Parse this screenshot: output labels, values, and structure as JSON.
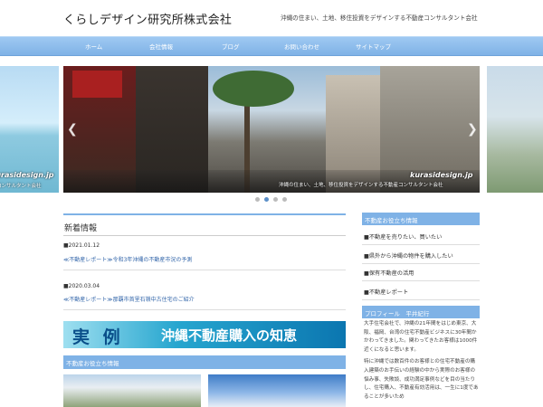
{
  "header": {
    "site_title": "くらしデザイン研究所株式会社",
    "tagline": "沖縄の住まい、土地、移住投資をデザインする不動産コンサルタント会社"
  },
  "nav": {
    "items": [
      {
        "label": "ホーム"
      },
      {
        "label": "会社情報"
      },
      {
        "label": "ブログ"
      },
      {
        "label": "お問い合わせ"
      },
      {
        "label": "サイトマップ"
      }
    ]
  },
  "slider": {
    "watermark": "kurasidesign.jp",
    "caption": "沖縄の住まい、土地、移住投資をデザインする不動産コンサルタント会社",
    "left_watermark": "kurasidesign.jp",
    "left_caption": "コンサルタント会社",
    "prev_icon": "chevron-left-icon",
    "next_icon": "chevron-right-icon",
    "dot_count": 4,
    "active_dot": 2
  },
  "news": {
    "heading": "新着情報",
    "items": [
      {
        "date": "■2021.01.12",
        "title": "≪不動産レポート≫令和3年沖縄の不動産市況の予測"
      },
      {
        "date": "■2020.03.04",
        "title": "≪不動産レポート≫那覇市首里石嶺中古住宅のご紹介"
      }
    ]
  },
  "banner": {
    "left": "実 例",
    "right": "沖縄不動産購入の知恵"
  },
  "section": {
    "heading": "不動産お役立ち情報"
  },
  "sidebar": {
    "useful_heading": "不動産お役立ち情報",
    "items": [
      {
        "label": "■不動産を売りたい、買いたい"
      },
      {
        "label": "■県外から沖縄の物件を購入したい"
      },
      {
        "label": "■保有不動産の活用"
      },
      {
        "label": "■不動産レポート"
      }
    ],
    "profile_heading": "プロフィール　平井紀行",
    "profile_p1": "大手住宅会社で、沖縄の21年間をはじめ東京、大阪、福岡、台湾の住宅不動産ビジネスに30年間かかわってきました。関わってきたお客様は1000件近くになると思います。",
    "profile_p2": "特に沖縄では数百件のお客様との住宅不動産の購入建築のお手伝いの経験の中から実際のお客様の悩み事、失敗談、成功満足事例などを目の当たりし、住宅購入、不動産有効活用は、一生に1度であることが多いため"
  },
  "colors": {
    "accent": "#7fb2e6",
    "link": "#3366aa",
    "banner_dark": "#0b76b0"
  }
}
